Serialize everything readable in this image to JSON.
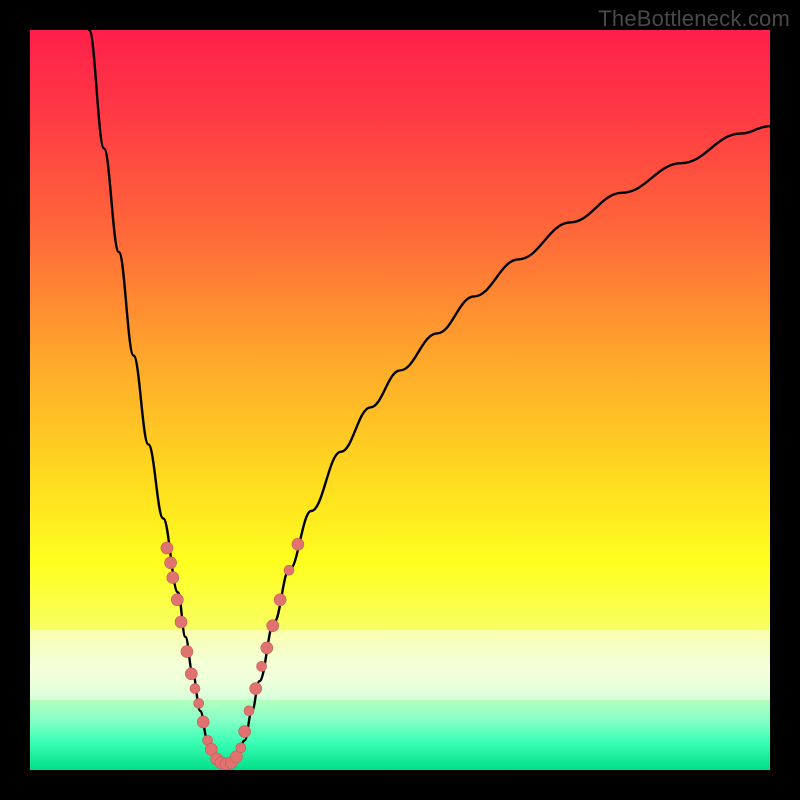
{
  "watermark": "TheBottleneck.com",
  "chart_data": {
    "type": "line",
    "title": "",
    "xlabel": "",
    "ylabel": "",
    "xlim": [
      0,
      100
    ],
    "ylim": [
      0,
      100
    ],
    "grid": false,
    "legend": false,
    "band": {
      "y0": 81,
      "y1": 90.5,
      "color": "pale-white"
    },
    "series": [
      {
        "name": "curve",
        "x": [
          8,
          10,
          12,
          14,
          16,
          18,
          20,
          21,
          22,
          23,
          24,
          25,
          26,
          27,
          28,
          29,
          30,
          31,
          33,
          35,
          38,
          42,
          46,
          50,
          55,
          60,
          66,
          73,
          80,
          88,
          96,
          100
        ],
        "y": [
          0,
          16,
          30,
          44,
          56,
          66,
          76,
          82,
          87,
          92,
          96,
          98,
          99.3,
          99.3,
          98,
          96,
          92,
          88,
          80,
          73,
          65,
          57,
          51,
          46,
          41,
          36,
          31,
          26,
          22,
          18,
          14,
          13
        ],
        "note": "y is percent from top (0) to bottom (100); curve starts top-left, dips to minimum near x≈26, rises toward right"
      }
    ],
    "markers": {
      "name": "scatter-dots",
      "color": "#e0736f",
      "points": [
        {
          "x": 18.5,
          "y": 70,
          "r": 6
        },
        {
          "x": 19,
          "y": 72,
          "r": 6
        },
        {
          "x": 19.3,
          "y": 74,
          "r": 6
        },
        {
          "x": 19.9,
          "y": 77,
          "r": 6
        },
        {
          "x": 20.4,
          "y": 80,
          "r": 6
        },
        {
          "x": 21.2,
          "y": 84,
          "r": 6
        },
        {
          "x": 21.8,
          "y": 87,
          "r": 6
        },
        {
          "x": 22.3,
          "y": 89,
          "r": 5
        },
        {
          "x": 22.8,
          "y": 91,
          "r": 5
        },
        {
          "x": 23.4,
          "y": 93.5,
          "r": 6
        },
        {
          "x": 24.0,
          "y": 96,
          "r": 5
        },
        {
          "x": 24.5,
          "y": 97.2,
          "r": 6
        },
        {
          "x": 25.2,
          "y": 98.5,
          "r": 6
        },
        {
          "x": 25.8,
          "y": 99.0,
          "r": 6
        },
        {
          "x": 26.5,
          "y": 99.2,
          "r": 6
        },
        {
          "x": 27.2,
          "y": 99.0,
          "r": 6
        },
        {
          "x": 27.9,
          "y": 98.2,
          "r": 6
        },
        {
          "x": 28.5,
          "y": 97.0,
          "r": 5
        },
        {
          "x": 29.0,
          "y": 94.8,
          "r": 6
        },
        {
          "x": 29.6,
          "y": 92.0,
          "r": 5
        },
        {
          "x": 30.5,
          "y": 89.0,
          "r": 6
        },
        {
          "x": 31.3,
          "y": 86.0,
          "r": 5
        },
        {
          "x": 32.0,
          "y": 83.5,
          "r": 6
        },
        {
          "x": 32.8,
          "y": 80.5,
          "r": 6
        },
        {
          "x": 33.8,
          "y": 77.0,
          "r": 6
        },
        {
          "x": 35.0,
          "y": 73.0,
          "r": 5
        },
        {
          "x": 36.2,
          "y": 69.5,
          "r": 6
        }
      ]
    },
    "background_gradient": {
      "direction": "vertical",
      "stops": [
        {
          "pos": 0,
          "color": "#ff1f4b"
        },
        {
          "pos": 0.45,
          "color": "#ffa92b"
        },
        {
          "pos": 0.72,
          "color": "#ffff1f"
        },
        {
          "pos": 1.0,
          "color": "#00e08a"
        }
      ]
    }
  }
}
